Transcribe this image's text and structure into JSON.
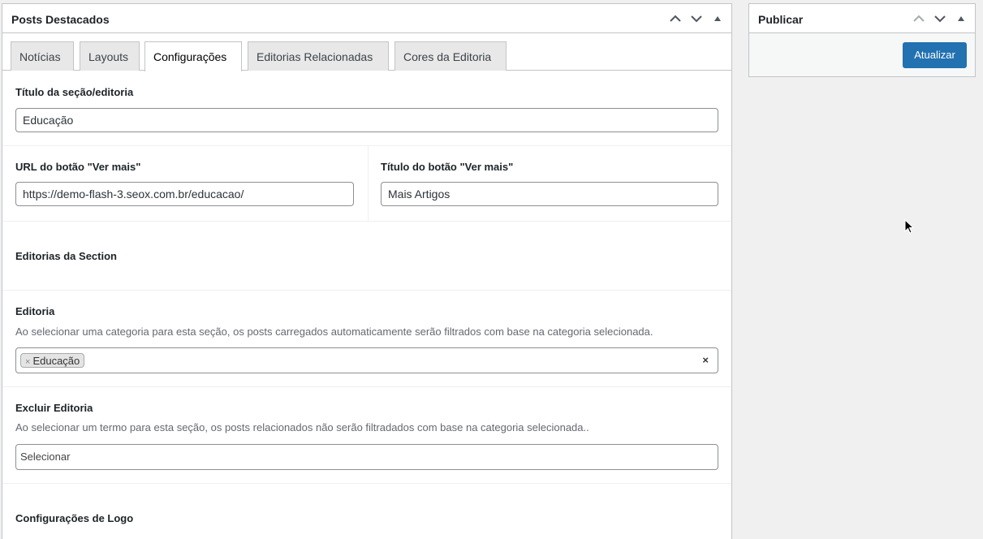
{
  "main_box": {
    "title": "Posts Destacados",
    "tabs": [
      {
        "label": "Notícias",
        "active": false
      },
      {
        "label": "Layouts",
        "active": false
      },
      {
        "label": "Configurações",
        "active": true
      },
      {
        "label": "Editorias Relacionadas",
        "active": false
      },
      {
        "label": "Cores da Editoria",
        "active": false
      }
    ],
    "fields": {
      "section_title": {
        "label": "Título da seção/editoria",
        "value": "Educação"
      },
      "more_url": {
        "label": "URL do botão \"Ver mais\"",
        "value": "https://demo-flash-3.seox.com.br/educacao/"
      },
      "more_title": {
        "label": "Título do botão \"Ver mais\"",
        "value": "Mais Artigos"
      },
      "editorias_section_heading": "Editorias da Section",
      "editoria": {
        "label": "Editoria",
        "description": "Ao selecionar uma categoria para esta seção, os posts carregados automaticamente serão filtrados com base na categoria selecionada.",
        "selected": "Educação",
        "chip_remove": "×",
        "clear": "×"
      },
      "excluir_editoria": {
        "label": "Excluir Editoria",
        "description": "Ao selecionar um termo para esta seção, os posts relacionados não serão filtradados com base na categoria selecionada..",
        "placeholder": "Selecionar"
      },
      "logo_heading": "Configurações de Logo"
    }
  },
  "side_box": {
    "title": "Publicar",
    "update_button": "Atualizar"
  },
  "colors": {
    "primary": "#2271b1",
    "border": "#c3c4c7",
    "background": "#f0f0f1"
  }
}
